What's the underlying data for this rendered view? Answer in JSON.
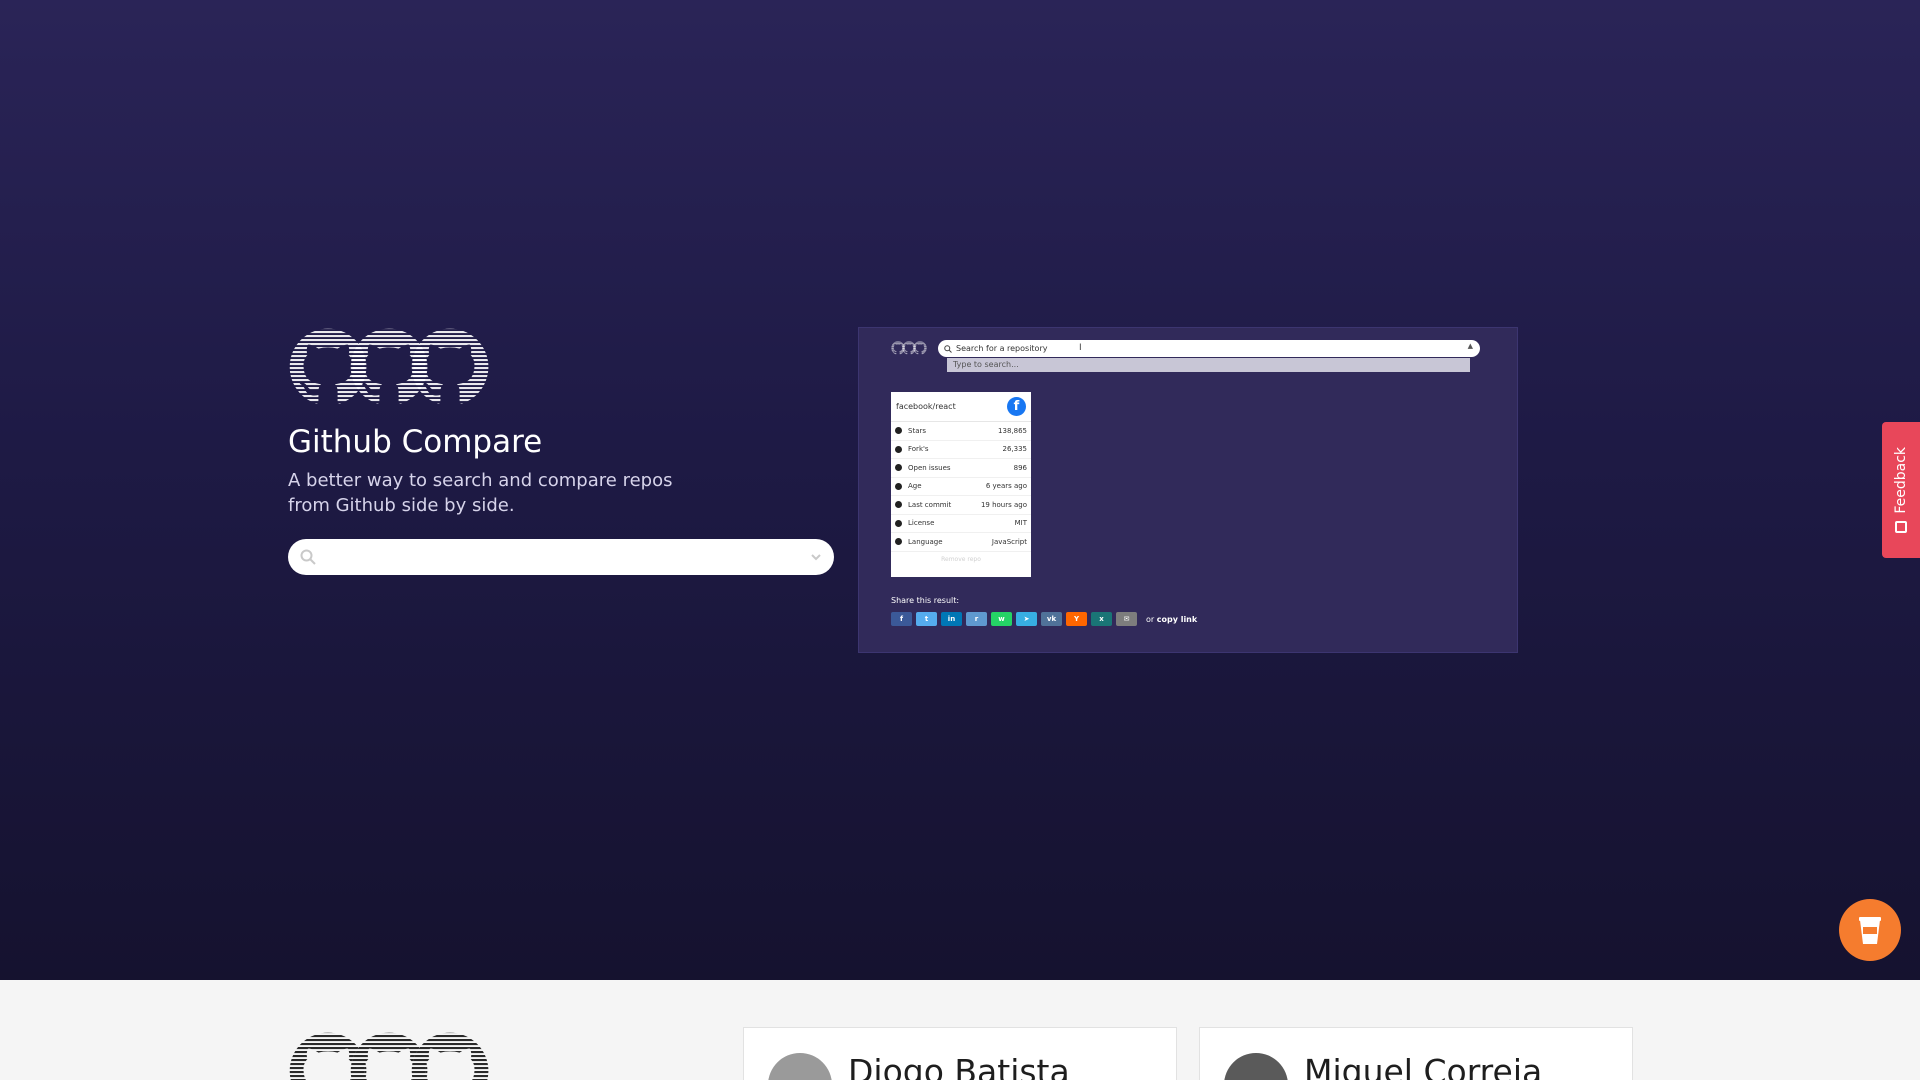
{
  "hero": {
    "title": "Github Compare",
    "subtitle": "A better way to search and compare repos from Github side by side.",
    "search": {
      "value": "",
      "placeholder": ""
    }
  },
  "preview": {
    "search_placeholder": "Search for a repository",
    "dropdown_text": "Type to search...",
    "card": {
      "repo": "facebook/react",
      "rows": [
        {
          "label": "Stars",
          "value": "138,865"
        },
        {
          "label": "Fork's",
          "value": "26,335"
        },
        {
          "label": "Open issues",
          "value": "896"
        },
        {
          "label": "Age",
          "value": "6 years ago"
        },
        {
          "label": "Last commit",
          "value": "19 hours ago"
        },
        {
          "label": "License",
          "value": "MIT"
        },
        {
          "label": "Language",
          "value": "JavaScript"
        }
      ],
      "remove_label": "Remove repo"
    },
    "share_label": "Share this result:",
    "share_buttons": [
      {
        "name": "facebook",
        "glyph": "f",
        "color": "#3b5998"
      },
      {
        "name": "twitter",
        "glyph": "t",
        "color": "#55acee"
      },
      {
        "name": "linkedin",
        "glyph": "in",
        "color": "#0077b5"
      },
      {
        "name": "reddit",
        "glyph": "r",
        "color": "#5f99cf"
      },
      {
        "name": "whatsapp",
        "glyph": "w",
        "color": "#25d366"
      },
      {
        "name": "telegram",
        "glyph": "➤",
        "color": "#37aee2"
      },
      {
        "name": "vk",
        "glyph": "vk",
        "color": "#507299"
      },
      {
        "name": "hackernews",
        "glyph": "Y",
        "color": "#ff6600"
      },
      {
        "name": "xing",
        "glyph": "x",
        "color": "#1a7576"
      },
      {
        "name": "email",
        "glyph": "✉",
        "color": "#7d7d7d"
      }
    ],
    "copy_prefix": "or",
    "copy_link": "copy link"
  },
  "feedback": {
    "label": "Feedback"
  },
  "authors": [
    {
      "name": "Diogo Batista"
    },
    {
      "name": "Miguel Correia"
    }
  ],
  "colors": {
    "hero_top": "#2a2457",
    "hero_bottom": "#15122f",
    "feedback": "#e8475a",
    "coffee": "#f57c2e"
  }
}
